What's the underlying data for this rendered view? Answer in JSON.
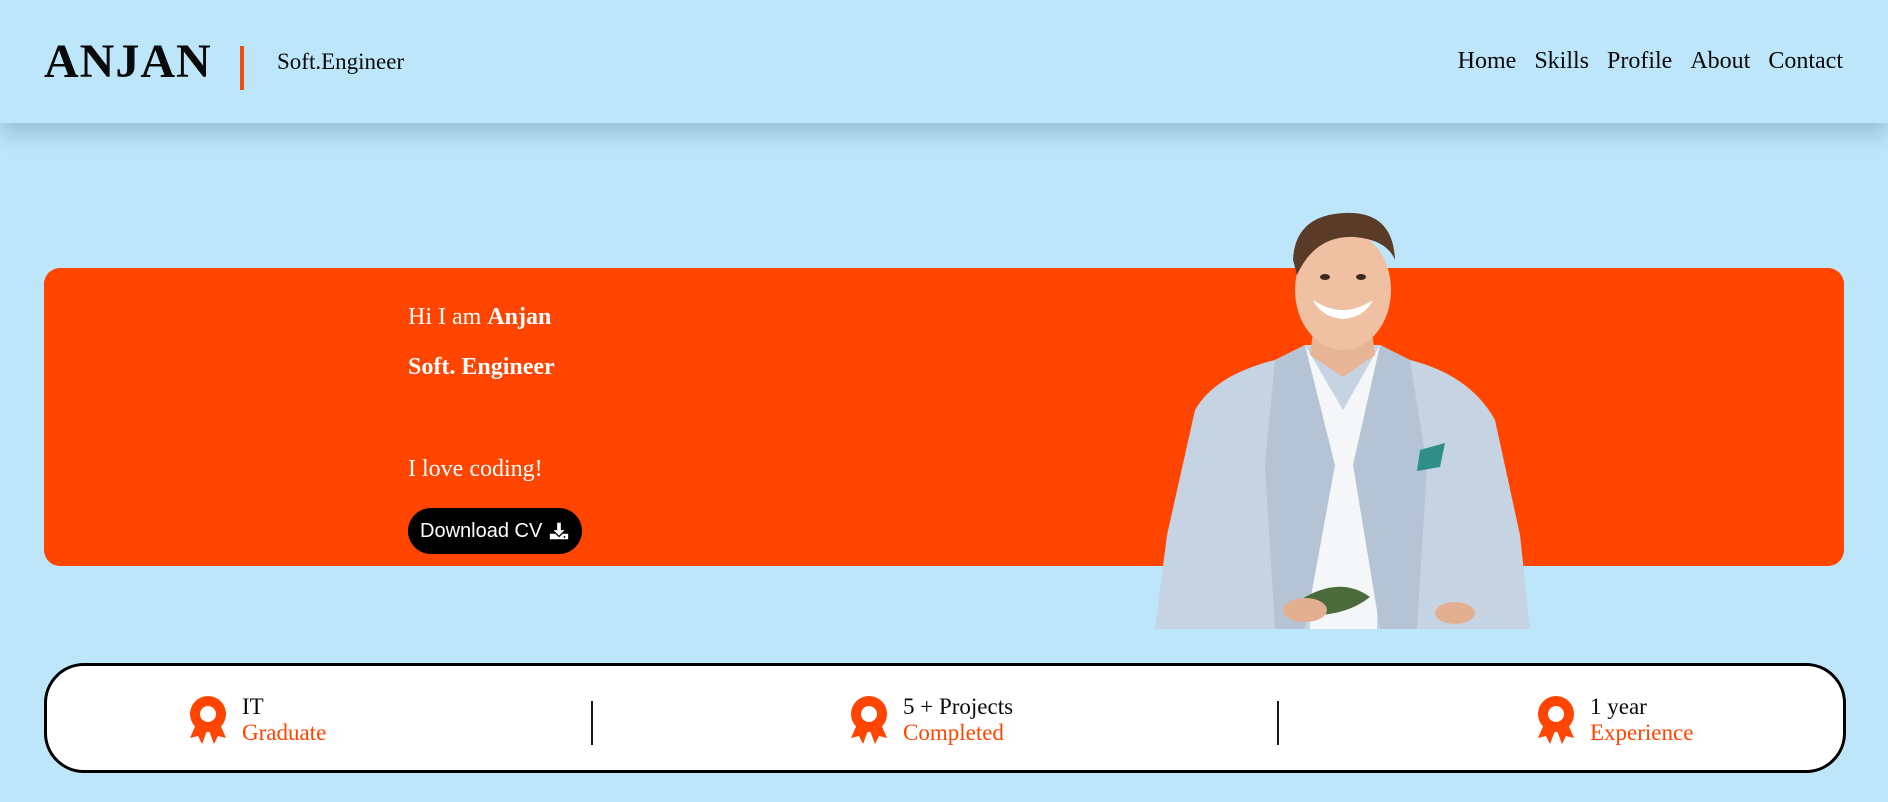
{
  "header": {
    "logo": "ANJAN",
    "tagline": "Soft.Engineer",
    "nav": [
      "Home",
      "Skills",
      "Profile",
      "About",
      "Contact"
    ]
  },
  "hero": {
    "greeting_prefix": "Hi I am ",
    "greeting_name": "Anjan",
    "role": "Soft. Engineer",
    "tagline": "I love coding!",
    "cv_button": "Download CV",
    "cv_icon": "download-icon"
  },
  "stats": [
    {
      "line1": "IT",
      "line2": "Graduate",
      "icon": "award-icon"
    },
    {
      "line1": "5 + Projects",
      "line2": "Completed",
      "icon": "award-icon"
    },
    {
      "line1": "1 year",
      "line2": "Experience",
      "icon": "award-icon"
    }
  ],
  "colors": {
    "background": "#bde6fb",
    "accent": "#ff4500",
    "text": "#0a0a0a",
    "button": "#000000"
  }
}
